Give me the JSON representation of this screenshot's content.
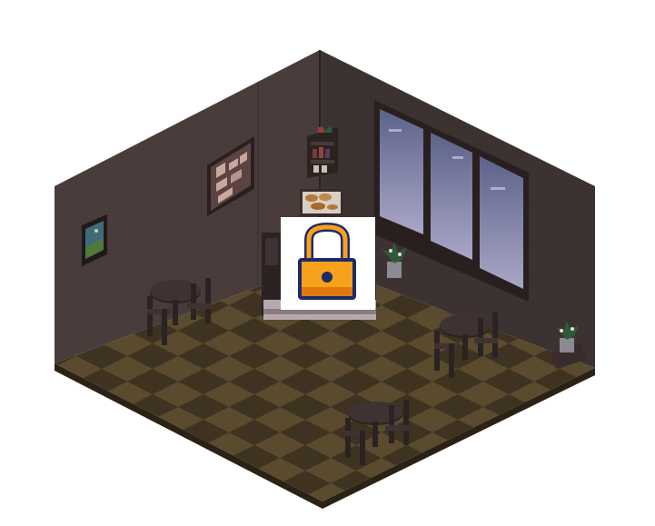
{
  "scene": {
    "kind": "isometric-pixel-room",
    "theme": "dim cafe at dusk",
    "colors": {
      "background": "#ffffff",
      "wall_left": "#4a3c3b",
      "wall_right": "#3d3232",
      "wall_edge": "#2a2222",
      "floor_light": "#5a4a2e",
      "floor_dark": "#3e3220",
      "floor_edge": "#2b2215",
      "window_sky_top": "#5c6288",
      "window_sky_bottom": "#a9a7c8",
      "window_frame": "#2a1f1f",
      "furniture_dark": "#2b2222",
      "furniture_mid": "#3f3232",
      "plant_green": "#2f5a3a",
      "lock_orange": "#f7a21b",
      "lock_dark": "#1f2a6b",
      "lock_shadow": "#e07a10"
    }
  },
  "locked_overlay": {
    "icon": "padlock-icon",
    "state": "locked"
  },
  "objects": {
    "tables": [
      "round-table-left",
      "round-table-right",
      "round-table-front"
    ],
    "wall_items": [
      "bulletin-board",
      "framed-landscape-picture",
      "wall-shelf-with-plants",
      "bread-display-shelf",
      "triple-window"
    ],
    "plants": [
      "potted-plant-window",
      "potted-plant-corner"
    ],
    "counter": "coffee-counter"
  }
}
